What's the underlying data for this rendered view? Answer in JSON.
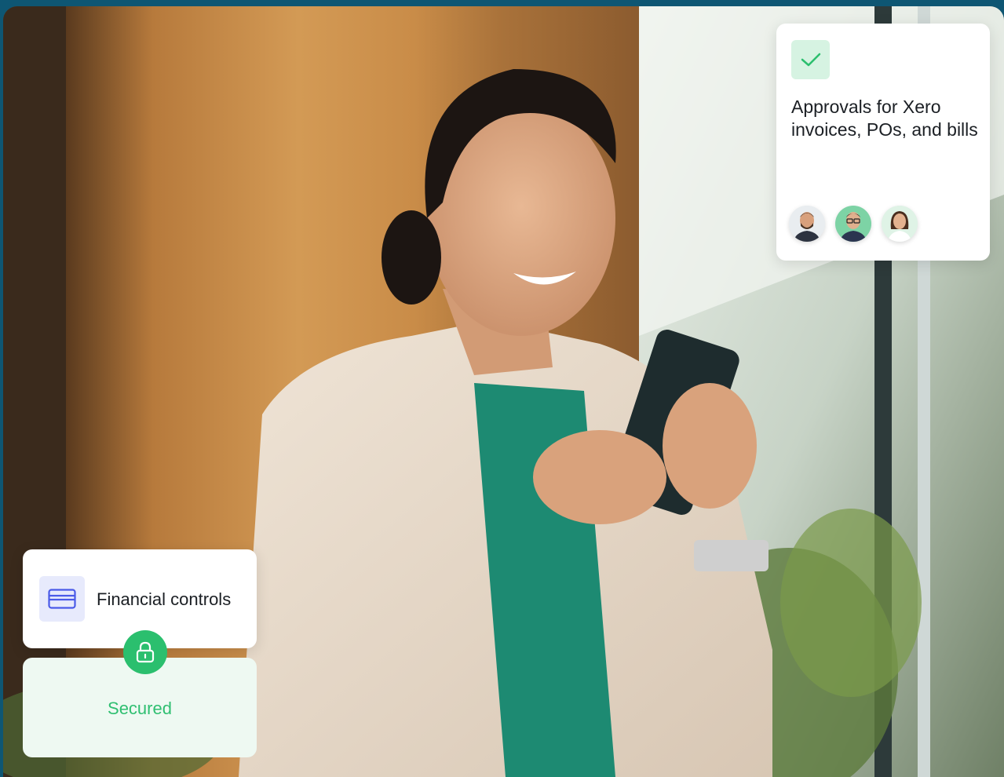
{
  "approvals_card": {
    "text": "Approvals for Xero invoices, POs, and bills",
    "icon": "check-icon",
    "avatars": [
      "avatar-man-beard",
      "avatar-man-glasses",
      "avatar-woman"
    ]
  },
  "financial_card": {
    "label": "Financial controls",
    "icon": "credit-card-icon"
  },
  "secured_card": {
    "label": "Secured",
    "icon": "lock-icon"
  },
  "colors": {
    "accent_green": "#2bbf6e",
    "card_icon_bg": "#e7eafc",
    "secured_bg": "#eef9f2"
  }
}
